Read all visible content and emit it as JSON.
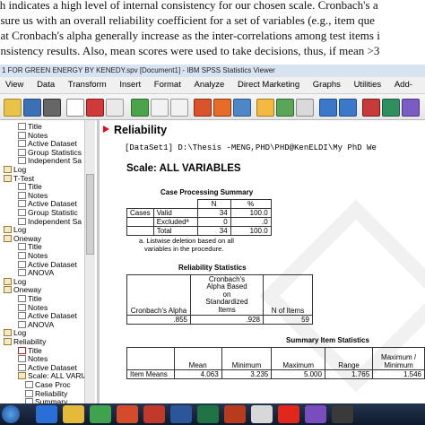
{
  "document": {
    "lines": [
      "ch indicates a high level of internal consistency for our chosen scale. Cronbach's a",
      "nsure us with an overall reliability coefficient for a set of variables (e.g., item que",
      "hat Cronbach's alpha generally increase as the inter-correlations among test items i",
      "onsistency results. Also, mean scores were used to take decisions, thus, if mean >3"
    ]
  },
  "window": {
    "title": "1 FOR GREEN ENERGY BY KENEDY.spv [Document1] - IBM SPSS Statistics Viewer"
  },
  "menu": [
    "View",
    "Data",
    "Transform",
    "Insert",
    "Format",
    "Analyze",
    "Direct Marketing",
    "Graphs",
    "Utilities",
    "Add-"
  ],
  "outline": {
    "items": [
      {
        "label": "Title",
        "indent": 2,
        "icon": "doc"
      },
      {
        "label": "Notes",
        "indent": 2,
        "icon": "doc"
      },
      {
        "label": "Active Dataset",
        "indent": 2,
        "icon": "doc"
      },
      {
        "label": "Group Statistics",
        "indent": 2,
        "icon": "doc"
      },
      {
        "label": "Independent Sa",
        "indent": 2,
        "icon": "doc"
      },
      {
        "label": "Log",
        "indent": 0,
        "icon": "log"
      },
      {
        "label": "T-Test",
        "indent": 0,
        "icon": "log"
      },
      {
        "label": "Title",
        "indent": 2,
        "icon": "doc"
      },
      {
        "label": "Notes",
        "indent": 2,
        "icon": "doc"
      },
      {
        "label": "Active Dataset",
        "indent": 2,
        "icon": "doc"
      },
      {
        "label": "Group Statistic",
        "indent": 2,
        "icon": "doc"
      },
      {
        "label": "Independent Sa",
        "indent": 2,
        "icon": "doc"
      },
      {
        "label": "Log",
        "indent": 0,
        "icon": "log"
      },
      {
        "label": "Oneway",
        "indent": 0,
        "icon": "log"
      },
      {
        "label": "Title",
        "indent": 2,
        "icon": "doc"
      },
      {
        "label": "Notes",
        "indent": 2,
        "icon": "doc"
      },
      {
        "label": "Active Dataset",
        "indent": 2,
        "icon": "doc"
      },
      {
        "label": "ANOVA",
        "indent": 2,
        "icon": "doc"
      },
      {
        "label": "Log",
        "indent": 0,
        "icon": "log"
      },
      {
        "label": "Oneway",
        "indent": 0,
        "icon": "log"
      },
      {
        "label": "Title",
        "indent": 2,
        "icon": "doc"
      },
      {
        "label": "Notes",
        "indent": 2,
        "icon": "doc"
      },
      {
        "label": "Active Dataset",
        "indent": 2,
        "icon": "doc"
      },
      {
        "label": "ANOVA",
        "indent": 2,
        "icon": "doc"
      },
      {
        "label": "Log",
        "indent": 0,
        "icon": "log"
      },
      {
        "label": "Reliability",
        "indent": 0,
        "icon": "log"
      },
      {
        "label": "Title",
        "indent": 2,
        "icon": "red"
      },
      {
        "label": "Notes",
        "indent": 2,
        "icon": "doc"
      },
      {
        "label": "Active Dataset",
        "indent": 2,
        "icon": "doc"
      },
      {
        "label": "Scale: ALL VARIA",
        "indent": 2,
        "icon": "log"
      },
      {
        "label": "Case Proc",
        "indent": 3,
        "icon": "doc"
      },
      {
        "label": "Reliability",
        "indent": 3,
        "icon": "doc"
      },
      {
        "label": "Summary",
        "indent": 3,
        "icon": "doc"
      }
    ]
  },
  "output": {
    "heading": "Reliability",
    "dataset_line": "[DataSet1] D:\\Thesis -MENG,PHD\\PHD@KenELDI\\My PhD We",
    "scale_title": "Scale: ALL VARIABLES",
    "case_processing": {
      "caption": "Case Processing Summary",
      "headers": [
        "",
        "",
        "N",
        "%"
      ],
      "rows": [
        [
          "Cases",
          "Valid",
          "34",
          "100.0"
        ],
        [
          "",
          "Excludedª",
          "0",
          ".0"
        ],
        [
          "",
          "Total",
          "34",
          "100.0"
        ]
      ],
      "footnote_1": "a. Listwise deletion based on all",
      "footnote_2": "variables in the procedure."
    },
    "reliability_stats": {
      "caption": "Reliability Statistics",
      "header_alpha": "Cronbach's Alpha",
      "header_std_1": "Cronbach's",
      "header_std_2": "Alpha Based",
      "header_std_3": "on",
      "header_std_4": "Standardized",
      "header_std_5": "Items",
      "header_n": "N of Items",
      "values": [
        ".855",
        ".928",
        "59"
      ]
    },
    "summary_item": {
      "caption": "Summary Item Statistics",
      "headers": [
        "",
        "Mean",
        "Minimum",
        "Maximum",
        "Range",
        "Maximum / Minimum"
      ],
      "row": [
        "Item Means",
        "4.063",
        "3.235",
        "5.000",
        "1.765",
        "1.546"
      ]
    }
  },
  "colors": {
    "accent": "#d12222",
    "titlebar": "#d8e3f1",
    "taskbar": "#1a2740"
  }
}
